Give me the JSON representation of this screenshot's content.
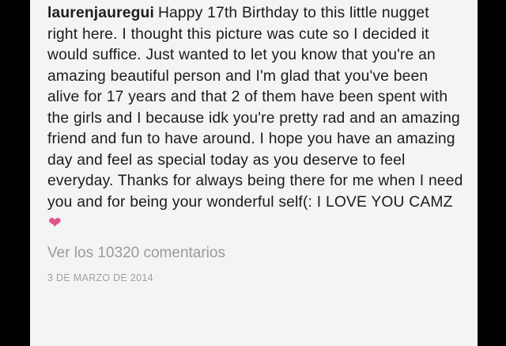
{
  "post": {
    "username": "laurenjauregui",
    "caption": "Happy 17th Birthday to this little nugget right here. I thought this picture was cute so I decided it would suffice. Just wanted to let you know that you're an amazing beautiful person and I'm glad that you've been alive for 17 years and that 2 of them have been spent with the girls and I because idk you're pretty rad and an amazing friend and fun to have around. I hope you have an amazing day and feel as special today as you deserve to feel everyday. Thanks for always being there for me when I need you and for being your wonderful self(: I LOVE YOU CAMZ",
    "emoji": "❤",
    "comments_link": "Ver los 10320 comentarios",
    "timestamp": "3 DE MARZO DE 2014"
  },
  "colors": {
    "background": "#000000",
    "card": "#f4f4f4",
    "text": "#1b1b1b",
    "muted": "#9a9a9a",
    "heart": "#e0548e"
  }
}
